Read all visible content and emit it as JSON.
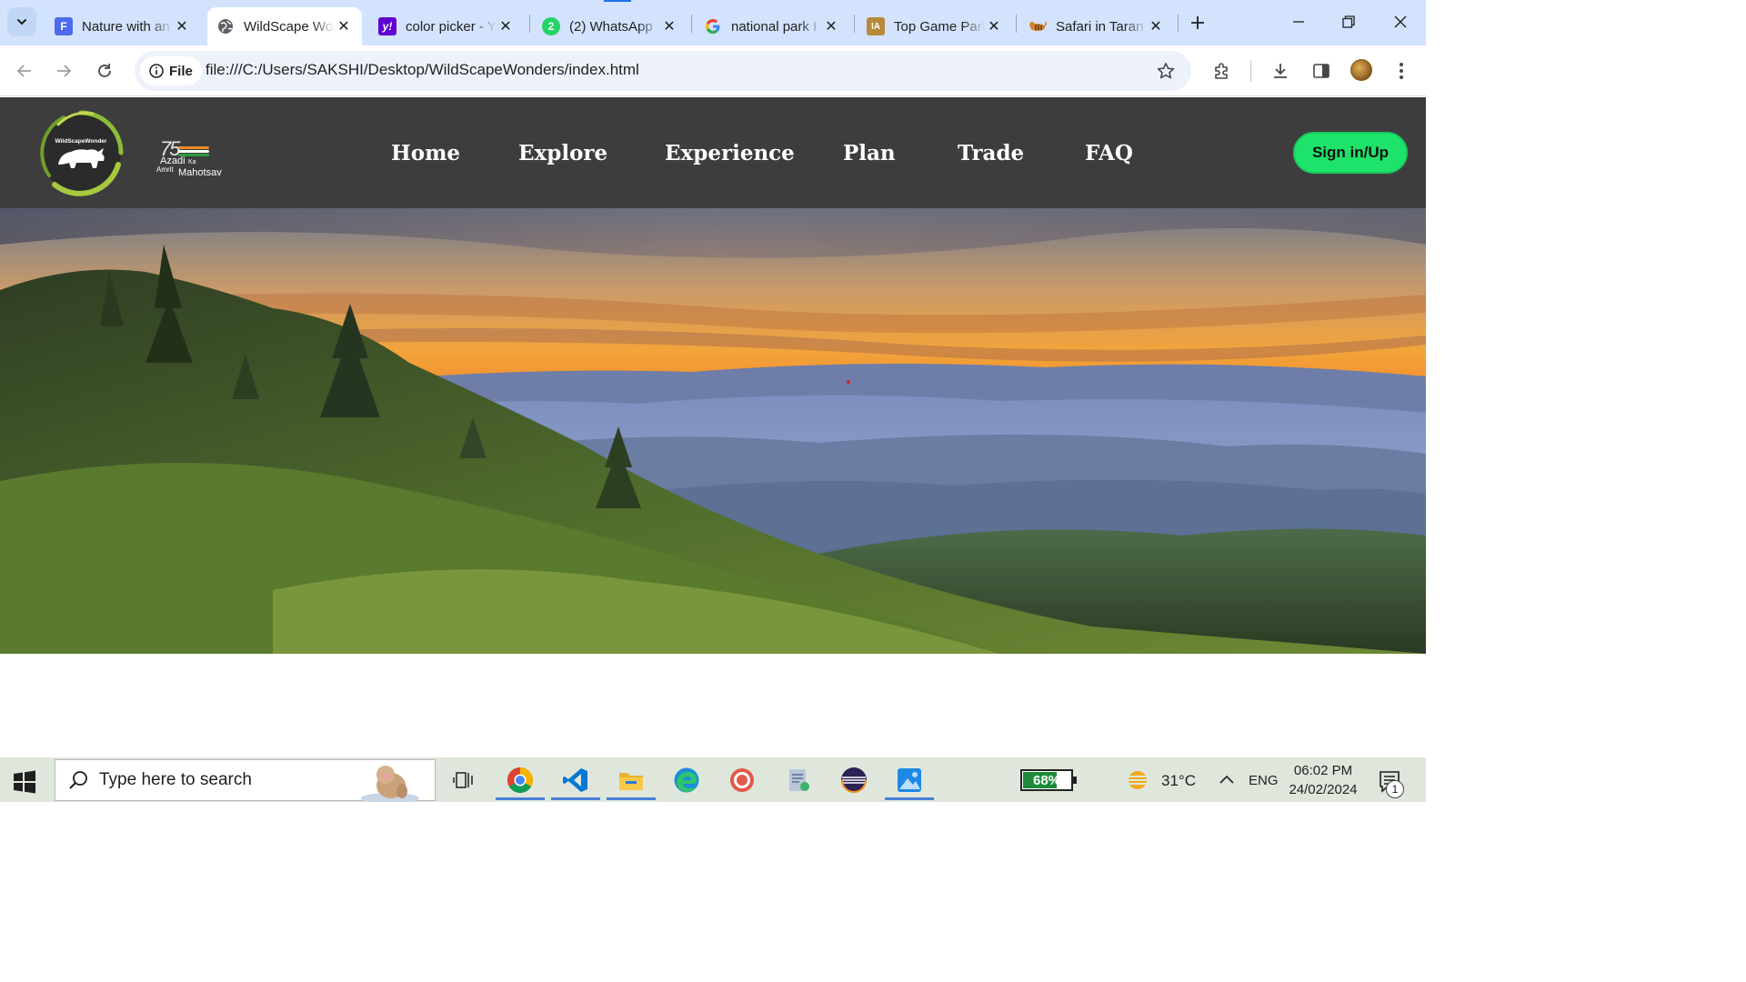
{
  "browser": {
    "tabs": [
      {
        "title": "Nature with an",
        "favicon": "forms-icon",
        "favicon_color": "#4f6bed",
        "active": false
      },
      {
        "title": "WildScape Wonders",
        "favicon": "globe-icon",
        "favicon_color": "#5f6368",
        "active": true
      },
      {
        "title": "color picker - Yahoo",
        "favicon": "yahoo-icon",
        "favicon_color": "#6001d2",
        "active": false
      },
      {
        "title": "(2) WhatsApp",
        "favicon": "whatsapp-icon",
        "favicon_color": "#25d366",
        "active": false
      },
      {
        "title": "national park I",
        "favicon": "google-icon",
        "favicon_color": "#4285f4",
        "active": false
      },
      {
        "title": "Top Game Park",
        "favicon": "ia-icon",
        "favicon_color": "#b8893a",
        "active": false
      },
      {
        "title": "Safari in Taran",
        "favicon": "tiger-icon",
        "favicon_color": "#d4832c",
        "active": false
      }
    ],
    "whatsapp_badge": "2",
    "site_chip_label": "File",
    "url": "file:///C:/Users/SAKSHI/Desktop/WildScapeWonders/index.html"
  },
  "site": {
    "logo_text": "WildScapeWonder",
    "azadi": {
      "number": "75",
      "line1": "Azadi",
      "line2": "Ka",
      "line3": "Amrit",
      "line4": "Mahotsav"
    },
    "nav": [
      "Home",
      "Explore",
      "Experience",
      "Plan",
      "Trade",
      "FAQ"
    ],
    "signin_label": "Sign in/Up",
    "accent_color": "#1ee36b",
    "nav_bg": "#3d3d3d"
  },
  "taskbar": {
    "search_placeholder": "Type here to search",
    "apps": [
      "task-view-icon",
      "chrome-icon",
      "vscode-icon",
      "file-explorer-icon",
      "edge-icon",
      "media-app-icon",
      "notepad-app-icon",
      "eclipse-icon",
      "photos-icon"
    ],
    "battery_percent": "68%",
    "battery_level": 0.68,
    "temperature": "31°C",
    "language": "ENG",
    "time": "06:02 PM",
    "date": "24/02/2024",
    "notification_count": "1"
  }
}
